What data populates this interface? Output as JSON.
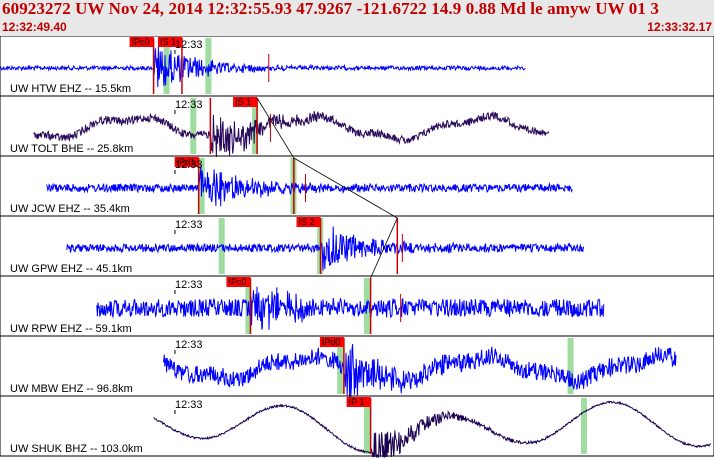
{
  "header": {
    "title": "60923272 UW Nov 24, 2014 12:32:55.93    47.9267 -121.6722 14.9 0.88 Md le amyw UW 01   3",
    "start_time": "12:32:49.40",
    "end_time": "12:33:32.17"
  },
  "colors": {
    "header_text": "#c00000",
    "trace_blue": "#0000ff",
    "trace_purple": "#2a0a5c",
    "trace_navy": "#1a0050",
    "pick_box": "#ff0000",
    "pick_line": "#cc0000",
    "window_green": "#9fdc9f",
    "theory_curve": "#000000"
  },
  "chart_data": {
    "type": "line",
    "time_start": "12:32:49.40",
    "time_end": "12:33:32.17",
    "origin_time": "12:32:55.93",
    "tick_label": "12:33",
    "tick_time": "12:33:00.00",
    "traces": [
      {
        "label": "UW HTW EHZ -- 15.5km",
        "tick_label": "12:33",
        "color": "trace_blue",
        "noise": "low",
        "wave": 0,
        "data_start": "12:32:49.40",
        "data_end": "12:33:20.90",
        "p_time": "12:32:58.60",
        "p_label": "IPc0",
        "s_time": "12:33:00.30",
        "s_label": "IS 1",
        "windows": [
          "12:32:59.20",
          "12:33:01.70"
        ],
        "marks": [
          "12:33:05.50"
        ]
      },
      {
        "label": "UW TOLT BHE -- 25.8km",
        "tick_label": "12:33",
        "color": "trace_purple",
        "noise": "wave",
        "wave": 1,
        "data_start": "12:32:51.40",
        "data_end": "12:33:22.30",
        "p_time": "12:33:02.00",
        "p_label": "",
        "s_time": "12:33:04.80",
        "s_label": "IS 1",
        "windows": [
          "12:33:00.80",
          "12:33:04.50"
        ],
        "marks": [
          "12:33:05.60"
        ]
      },
      {
        "label": "UW JCW EHZ -- 35.4km",
        "tick_label": "12:33",
        "color": "trace_blue",
        "noise": "mid",
        "wave": 0,
        "data_start": "12:32:52.20",
        "data_end": "12:33:23.70",
        "p_time": "12:33:01.30",
        "p_label": "IPd1",
        "s_time": "12:33:07.00",
        "s_label": "",
        "windows": [
          "12:33:01.30",
          "12:33:06.80"
        ],
        "marks": [
          "12:33:07.70"
        ]
      },
      {
        "label": "UW GPW EHZ -- 45.1km",
        "tick_label": "12:33",
        "color": "trace_blue",
        "noise": "mid",
        "wave": 0,
        "data_start": "12:32:53.40",
        "data_end": "12:33:24.40",
        "p_time": "12:33:08.60",
        "p_label": "IS 2",
        "s_time": "12:33:13.20",
        "s_label": "",
        "windows": [
          "12:33:02.50",
          "12:33:08.40"
        ],
        "marks": [
          "12:33:13.50"
        ]
      },
      {
        "label": "UW RPW EHZ -- 59.1km",
        "tick_label": "12:33",
        "color": "trace_blue",
        "noise": "high",
        "wave": 0,
        "data_start": "12:32:55.20",
        "data_end": "12:33:25.60",
        "p_time": "12:33:04.40",
        "p_label": "IPc0",
        "s_time": "12:33:11.60",
        "s_label": "",
        "windows": [
          "12:33:04.10",
          "12:33:11.20"
        ],
        "marks": [
          "12:33:13.40"
        ]
      },
      {
        "label": "UW MBW EHZ -- 96.8km",
        "tick_label": "12:33",
        "color": "trace_blue",
        "noise": "high",
        "wave": 1,
        "data_start": "12:32:59.20",
        "data_end": "12:33:29.90",
        "p_time": "12:33:10.00",
        "p_label": "IPd0",
        "s_time": "",
        "s_label": "",
        "windows": [
          "12:33:09.60",
          "12:33:23.40"
        ],
        "marks": []
      },
      {
        "label": "UW SHUK BHZ -- 103.0km",
        "tick_label": "12:33",
        "color": "trace_navy",
        "noise": "slow",
        "wave": 2,
        "data_start": "12:32:58.60",
        "data_end": "12:33:32.00",
        "p_time": "12:33:11.60",
        "p_label": "IP 1",
        "s_time": "",
        "s_label": "",
        "windows": [
          "12:33:11.20",
          "12:33:24.20"
        ],
        "marks": []
      }
    ]
  }
}
